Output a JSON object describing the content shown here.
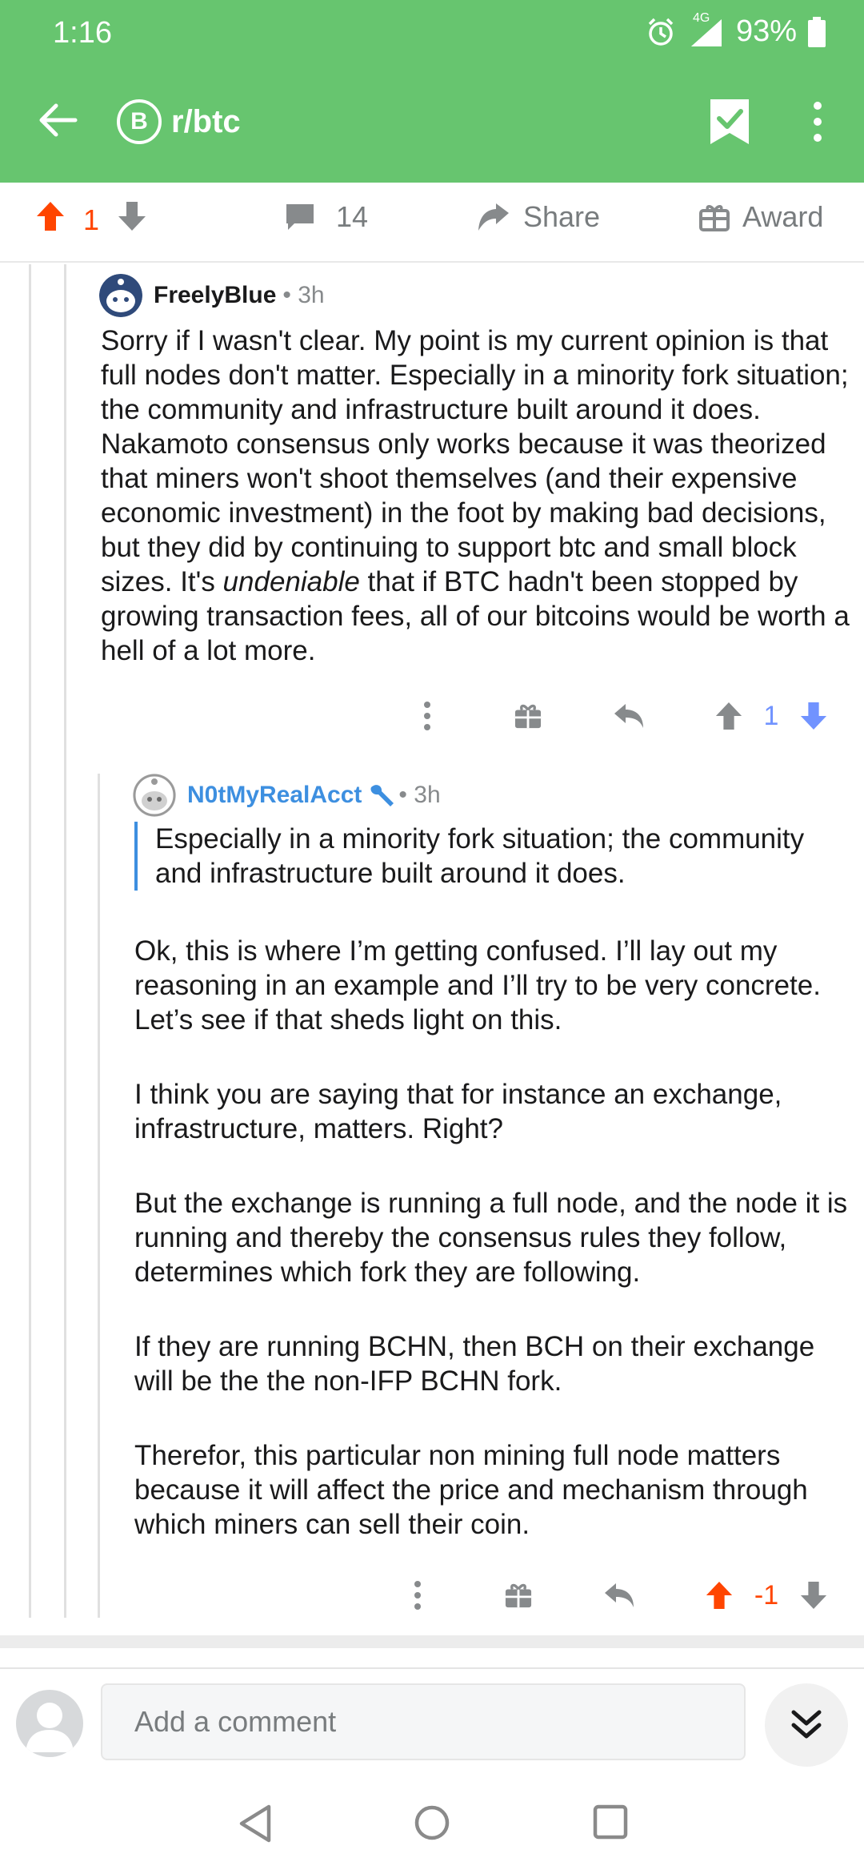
{
  "status_bar": {
    "time": "1:16",
    "network": "4G",
    "battery": "93%"
  },
  "app_bar": {
    "subreddit": "r/btc",
    "subreddit_icon_letter": "B"
  },
  "post_actions": {
    "upvotes": "1",
    "comments": "14",
    "share_label": "Share",
    "award_label": "Award"
  },
  "comments": [
    {
      "author": "FreelyBlue",
      "meta": "• 3h",
      "body_parts": {
        "before": "Sorry if I wasn't clear. My point is my current opinion is that full nodes don't matter. Especially in a minority fork situation; the community and infrastructure built around it does. Nakamoto consensus only works because it was theorized that miners won't shoot themselves (and their expensive economic investment) in the foot by making bad decisions, but they did by continuing to support btc and small block sizes. It's ",
        "emphasis": "undeniable",
        "after": " that if BTC hadn't been stopped by growing transaction fees, all of our bitcoins would be worth a hell of a lot more."
      },
      "score": "1"
    },
    {
      "author": "N0tMyRealAcct",
      "meta": "• 3h",
      "quote": "Especially in a minority fork situation; the community and infrastructure built around it does.",
      "paragraphs": [
        "Ok, this is where I’m getting confused. I’ll lay out my reasoning in an example and I’ll try to be very concrete. Let’s see if that sheds light on this.",
        "I think you are saying that for instance an exchange, infrastructure, matters. Right?",
        "But the exchange is running a full node, and the node it is running and thereby the consensus rules they follow, determines which fork they are following.",
        "If they are running BCHN, then BCH on their exchange will be the the non-IFP BCHN fork.",
        "Therefor, this particular non mining full node matters because it will affect the price and mechanism through which miners can sell their coin."
      ],
      "score": "-1"
    }
  ],
  "composer": {
    "placeholder": "Add a comment"
  },
  "colors": {
    "brand_green": "#67c56f",
    "upvote_orange": "#ff4500",
    "downvote_blue": "#7193ff",
    "link_blue": "#3d8fe0"
  }
}
